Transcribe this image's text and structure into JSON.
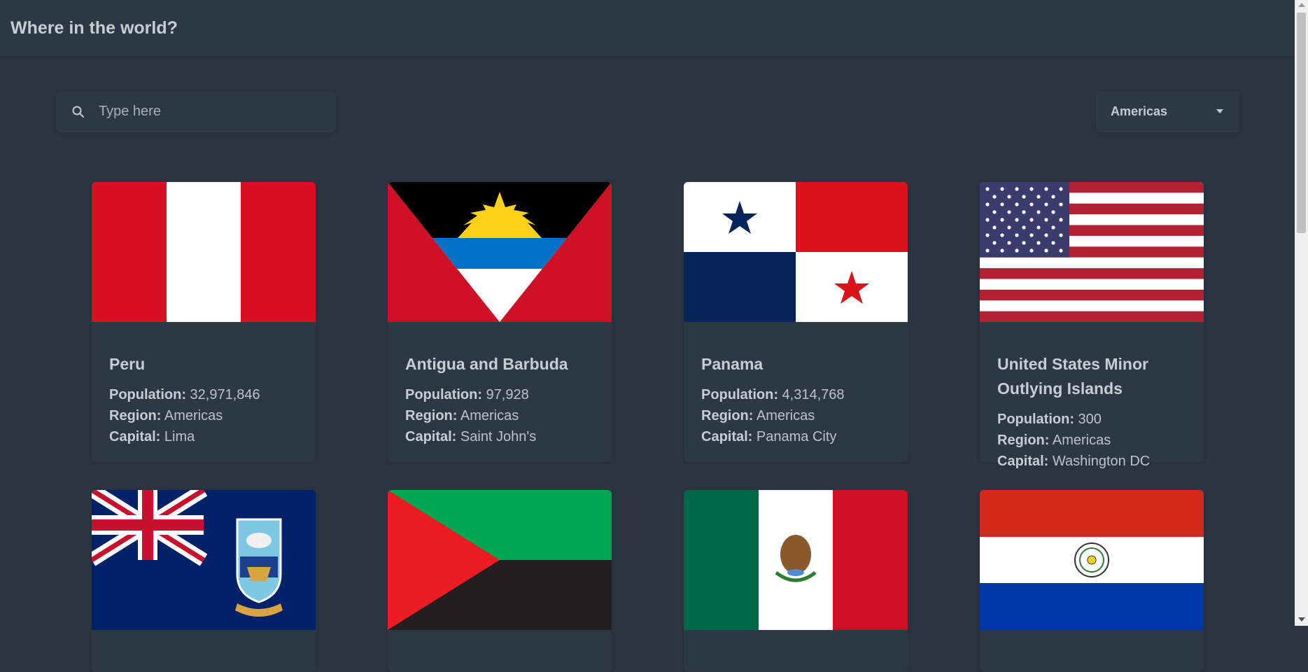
{
  "header": {
    "title": "Where in the world?"
  },
  "search": {
    "placeholder": "Type here",
    "icon": "search-icon"
  },
  "filter": {
    "selected": "Americas",
    "icon": "caret-down-icon"
  },
  "labels": {
    "population": "Population:",
    "region": "Region:",
    "capital": "Capital:"
  },
  "countries": [
    {
      "name": "Peru",
      "population": "32,971,846",
      "region": "Americas",
      "capital": "Lima",
      "flag": "peru-flag"
    },
    {
      "name": "Antigua and Barbuda",
      "population": "97,928",
      "region": "Americas",
      "capital": "Saint John's",
      "flag": "antigua-and-barbuda-flag"
    },
    {
      "name": "Panama",
      "population": "4,314,768",
      "region": "Americas",
      "capital": "Panama City",
      "flag": "panama-flag"
    },
    {
      "name": "United States Minor Outlying Islands",
      "population": "300",
      "region": "Americas",
      "capital": "Washington DC",
      "flag": "usa-flag"
    },
    {
      "flag": "falkland-islands-flag"
    },
    {
      "flag": "western-sahara-flag"
    },
    {
      "flag": "mexico-flag"
    },
    {
      "flag": "paraguay-flag"
    }
  ],
  "colors": {
    "background": "#2b3440",
    "element": "#2c3845",
    "text": "#c8cdd4"
  }
}
